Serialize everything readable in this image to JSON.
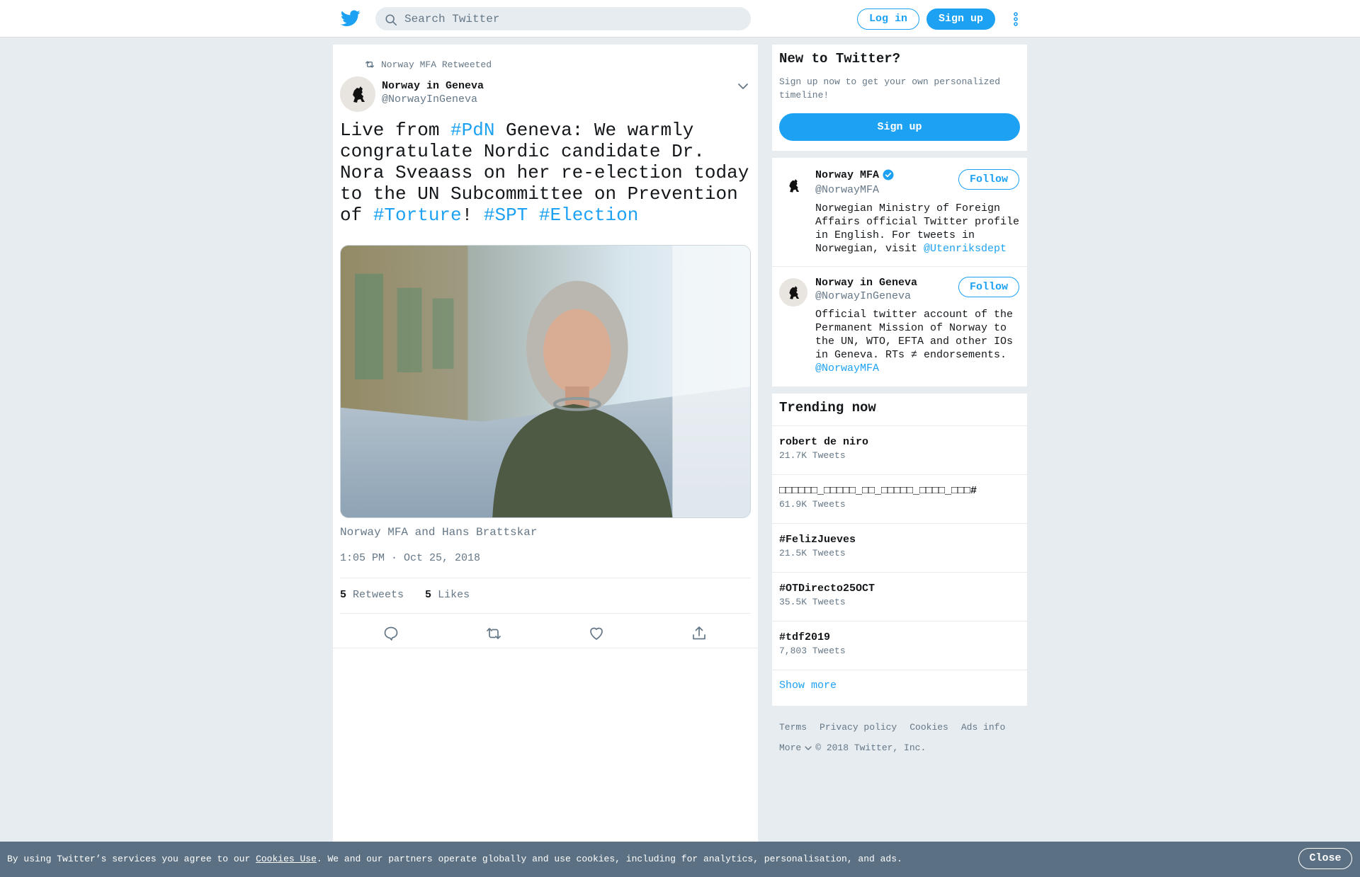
{
  "topbar": {
    "logo_icon": "twitter-bird-icon",
    "search_placeholder": "Search Twitter",
    "login_label": "Log in",
    "signup_label": "Sign up",
    "more_icon": "vertical-dots-icon"
  },
  "tweet": {
    "retweeted_by": "Norway MFA Retweeted",
    "author_name": "Norway in Geneva",
    "author_handle": "@NorwayInGeneva",
    "text_parts": [
      {
        "t": "Live from ",
        "link": false
      },
      {
        "t": "#PdN",
        "link": true
      },
      {
        "t": " Geneva: We warmly congratulate Nordic candidate Dr. Nora Sveaass on her re-election today to the UN Subcommittee on Prevention of ",
        "link": false
      },
      {
        "t": "#Torture",
        "link": true
      },
      {
        "t": "! ",
        "link": false
      },
      {
        "t": "#SPT",
        "link": true
      },
      {
        "t": " ",
        "link": false
      },
      {
        "t": "#Election",
        "link": true
      }
    ],
    "tagged": "Norway MFA and Hans Brattskar",
    "timestamp": "1:05 PM · Oct 25, 2018",
    "retweets_count": "5",
    "retweets_label": "Retweets",
    "likes_count": "5",
    "likes_label": "Likes"
  },
  "sidebar": {
    "new_title": "New to Twitter?",
    "new_subtitle": "Sign up now to get your own personalized timeline!",
    "signup_label": "Sign up",
    "accounts": [
      {
        "name": "Norway MFA",
        "handle": "@NorwayMFA",
        "verified": true,
        "bio": "Norwegian Ministry of Foreign Affairs official Twitter profile in English. For tweets in Norwegian, visit ",
        "bio_link": "@Utenriksdept",
        "follow_label": "Follow"
      },
      {
        "name": "Norway in Geneva",
        "handle": "@NorwayInGeneva",
        "verified": false,
        "bio": "Official twitter account of the Permanent Mission of Norway to the UN, WTO, EFTA and other IOs in Geneva. RTs ≠ endorsements. ",
        "bio_link": "@NorwayMFA",
        "follow_label": "Follow"
      }
    ],
    "trending_title": "Trending now",
    "trends": [
      {
        "name": "robert de niro",
        "count": "21.7K Tweets"
      },
      {
        "name": "□□□□□□_□□□□□_□□_□□□□□_□□□□_□□□#",
        "count": "61.9K Tweets"
      },
      {
        "name": "#FelizJueves",
        "count": "21.5K Tweets"
      },
      {
        "name": "#OTDirecto25OCT",
        "count": "35.5K Tweets"
      },
      {
        "name": "#tdf2019",
        "count": "7,803 Tweets"
      }
    ],
    "show_more": "Show more"
  },
  "footer": {
    "links": [
      "Terms",
      "Privacy policy",
      "Cookies",
      "Ads info"
    ],
    "more_label": "More",
    "copyright": "© 2018 Twitter, Inc."
  },
  "cookiebar": {
    "text_before": "By using Twitter’s services you agree to our ",
    "link": "Cookies Use",
    "text_after": ". We and our partners operate globally and use cookies, including for analytics, personalisation, and ads.",
    "close_label": "Close"
  },
  "colors": {
    "accent": "#1da1f2",
    "background": "#e6ecf0",
    "secondary_text": "#657786",
    "cookiebar": "#5b7083"
  }
}
